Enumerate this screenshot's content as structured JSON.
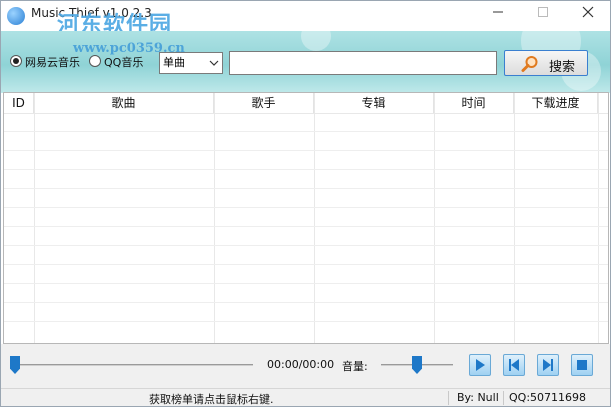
{
  "window": {
    "title": "Music Thief  v1.0.2.3"
  },
  "watermark": {
    "text": "河东软件园",
    "url": "www.pc0359.cn"
  },
  "search": {
    "source_options": [
      "网易云音乐",
      "QQ音乐"
    ],
    "selected_source": "网易云音乐",
    "type_value": "单曲",
    "query_value": "",
    "button_label": "搜索"
  },
  "table": {
    "columns": [
      "ID",
      "歌曲",
      "歌手",
      "专辑",
      "时间",
      "下载进度"
    ],
    "rows": []
  },
  "player": {
    "progress": 0,
    "time": "00:00/00:00",
    "volume_label": "音量:",
    "volume_level": 0.5
  },
  "status": {
    "hint": "获取榜单请点击鼠标右键.",
    "author": "By: Null",
    "qq": "QQ:50711698"
  },
  "colors": {
    "accent": "#1e78c8",
    "banner": "#9fd9db",
    "search_border": "#3a7fd0"
  }
}
